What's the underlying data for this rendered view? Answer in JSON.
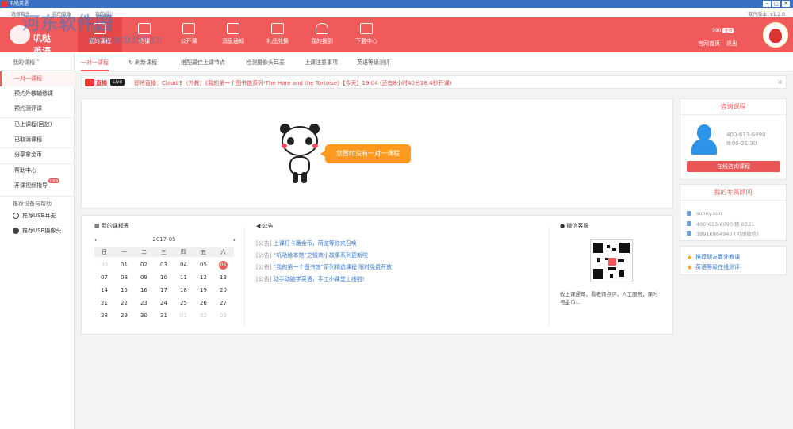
{
  "window": {
    "title": "叽哒英语",
    "version": "软件版本: v1.2.0"
  },
  "topsmall": [
    "选择软件",
    "我的软件",
    "我的设计"
  ],
  "watermark": {
    "line1": "河东软件园",
    "line2": "www.pc0359.cn"
  },
  "logo": {
    "text": "叽哒英语"
  },
  "nav": [
    {
      "label": "我的课程",
      "icon": "course-icon"
    },
    {
      "label": "约课",
      "icon": "book-icon"
    },
    {
      "label": "公开课",
      "icon": "open-class-icon"
    },
    {
      "label": "消息通知",
      "icon": "mail-icon"
    },
    {
      "label": "礼品兑换",
      "icon": "gift-icon"
    },
    {
      "label": "我的报到",
      "icon": "user-icon"
    },
    {
      "label": "下载中心",
      "icon": "download-icon"
    }
  ],
  "header_right": {
    "coins": "590",
    "coins_badge": "金币",
    "home": "官网首页",
    "logout": "退出"
  },
  "sidebar": {
    "head": "我的课程",
    "items": [
      "一对一课程",
      "预约外教辅修课",
      "预约测评课",
      "已上课程(回放)",
      "已取消课程",
      "分享拿金币",
      "帮助中心",
      "开课视频指导"
    ],
    "new_badge": "new",
    "devices_head": "推荐设备与帮助",
    "devices": [
      "推荐USB耳麦",
      "推荐USB摄像头"
    ]
  },
  "tabs": [
    "一对一课程",
    "刷新课程",
    "搭配最佳上课节点",
    "检测摄像头耳麦",
    "上课注意事项",
    "英语等级测评"
  ],
  "live": {
    "label": "直播",
    "tag": "Live",
    "message": "即将直播：Claud E（外教）《我的第一个图书馆系列-The Hare and the Tortoise》【今天】19:04 (还有8小时40分28.4秒开课)"
  },
  "empty_message": "您暂时没有一对一课程",
  "schedule": {
    "title": "我的课程表",
    "month": "2017-05",
    "weekdays": [
      "日",
      "一",
      "二",
      "三",
      "四",
      "五",
      "六"
    ],
    "rows": [
      [
        "30",
        "01",
        "02",
        "03",
        "04",
        "05",
        "06"
      ],
      [
        "07",
        "08",
        "09",
        "10",
        "11",
        "12",
        "13"
      ],
      [
        "14",
        "15",
        "16",
        "17",
        "18",
        "19",
        "20"
      ],
      [
        "21",
        "22",
        "23",
        "24",
        "25",
        "26",
        "27"
      ],
      [
        "28",
        "29",
        "30",
        "31",
        "01",
        "02",
        "03"
      ]
    ],
    "today": "06"
  },
  "notice": {
    "title": "公告",
    "items": [
      {
        "tag": "[公告]",
        "text": "上课打卡赢金币，萌宠等你来召唤！"
      },
      {
        "tag": "[公告]",
        "text": "“叽哒绘本馆”之情商小故事系列更新啦"
      },
      {
        "tag": "[公告]",
        "text": "“我的第一个图书馆”系列精选课程 限时免费开放!"
      },
      {
        "tag": "[公告]",
        "text": "动手动脑学英语，手工小课堂上线啦!"
      }
    ]
  },
  "wechat": {
    "title": "微信客服",
    "text": "收上课通知，看老师点评，人工服务，课时与金币..."
  },
  "consult": {
    "title": "咨询课程",
    "phone": "400-613-6090",
    "hours": "8:00-21:30",
    "button": "在线咨询课程"
  },
  "advisor": {
    "title": "我的专属顾问",
    "name": "sunny.sun",
    "phone": "400-613-6090 转 8331",
    "mobile": "18916964940 (可加微信)"
  },
  "recommend": [
    "推荐朋友赢外教课",
    "英语等级在线测评"
  ],
  "colors": {
    "primary": "#f05a5a",
    "orange": "#ff9a1f",
    "link": "#3a7bd5"
  }
}
